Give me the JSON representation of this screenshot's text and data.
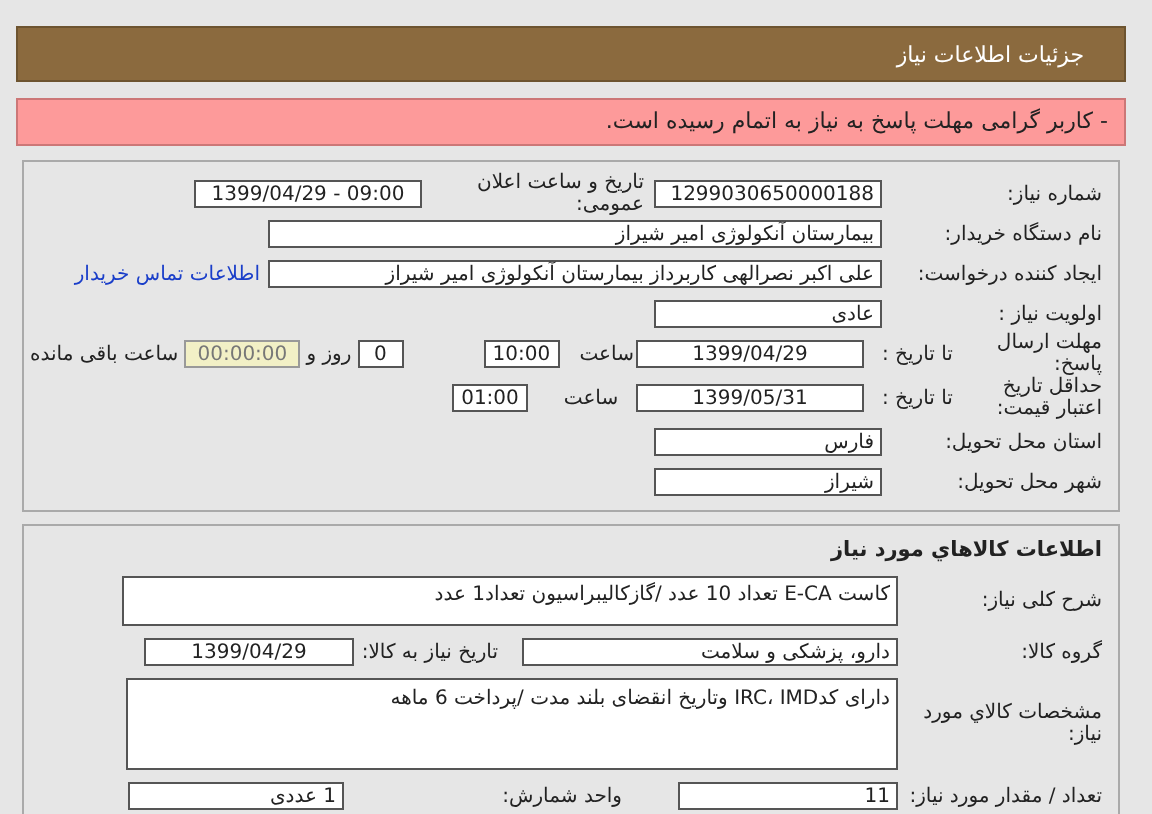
{
  "header": {
    "title": "جزئیات اطلاعات نیاز"
  },
  "alert": {
    "text": "- کاربر گرامی مهلت پاسخ به نیاز به اتمام رسیده است."
  },
  "need_details": {
    "need_number": {
      "label": "شماره نیاز:",
      "value": "1299030650000188"
    },
    "announce_datetime": {
      "label": "تاریخ و ساعت اعلان عمومی:",
      "value": "1399/04/29 - 09:00"
    },
    "buyer_name": {
      "label": "نام دستگاه خریدار:",
      "value": "بیمارستان آنکولوژی امیر شیراز"
    },
    "requester": {
      "label": "ایجاد کننده درخواست:",
      "value": "علی اکبر نصرالهی کاربرداز بیمارستان آنکولوژی امیر شیراز",
      "contact_link": "اطلاعات تماس خریدار"
    },
    "priority": {
      "label": "اولویت نیاز :",
      "value": "عادی"
    },
    "response_deadline": {
      "label": "مهلت ارسال پاسخ:",
      "to_date_label": "تا تاریخ :",
      "date": "1399/04/29",
      "time_label": "ساعت",
      "time": "10:00",
      "days": "0",
      "days_label": "روز و",
      "remaining": "00:00:00",
      "remaining_label": "ساعت باقی مانده"
    },
    "price_validity": {
      "label": "حداقل تاریخ اعتبار قیمت:",
      "to_date_label": "تا تاریخ :",
      "date": "1399/05/31",
      "time_label": "ساعت",
      "time": "01:00"
    },
    "delivery_province": {
      "label": "استان محل تحویل:",
      "value": "فارس"
    },
    "delivery_city": {
      "label": "شهر محل تحویل:",
      "value": "شیراز"
    }
  },
  "goods": {
    "title": "اطلاعات کالاهاي مورد نیاز",
    "description": {
      "label": "شرح کلی نیاز:",
      "value": "کاست E-CA تعداد 10 عدد /گازکالیبراسیون تعداد1 عدد"
    },
    "goods_group": {
      "label": "گروه کالا:",
      "value": "دارو، پزشکی و سلامت"
    },
    "need_date": {
      "label": "تاریخ نیاز به کالا:",
      "value": "1399/04/29"
    },
    "specs": {
      "label": "مشخصات کالاي مورد نیاز:",
      "value": "دارای کدIRC، IMD وتاریخ انقضای بلند مدت /پرداخت 6 ماهه"
    },
    "quantity": {
      "label": "تعداد / مقدار مورد نیاز:",
      "value": "11"
    },
    "unit": {
      "label": "واحد شمارش:",
      "value": "1 عددی"
    }
  }
}
